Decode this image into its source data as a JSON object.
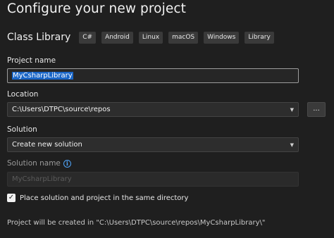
{
  "title": "Configure your new project",
  "template": {
    "name": "Class Library",
    "tags": [
      "C#",
      "Android",
      "Linux",
      "macOS",
      "Windows",
      "Library"
    ]
  },
  "project_name": {
    "label": "Project name",
    "value": "MyCsharpLibrary"
  },
  "location": {
    "label": "Location",
    "value": "C:\\Users\\DTPC\\source\\repos",
    "browse_label": "..."
  },
  "solution": {
    "label": "Solution",
    "value": "Create new solution"
  },
  "solution_name": {
    "label": "Solution name",
    "placeholder": "MyCsharpLibrary"
  },
  "same_directory": {
    "checked": true,
    "label": "Place solution and project in the same directory"
  },
  "footer": {
    "path_text": "Project will be created in \"C:\\Users\\DTPC\\source\\repos\\MyCsharpLibrary\\\""
  },
  "icons": {
    "info": "info-icon",
    "dropdown": "chevron-down-icon",
    "check": "checkmark-icon"
  },
  "colors": {
    "background": "#1f1f1f",
    "selection": "#1a66c7",
    "info_accent": "#4fa3f7"
  }
}
